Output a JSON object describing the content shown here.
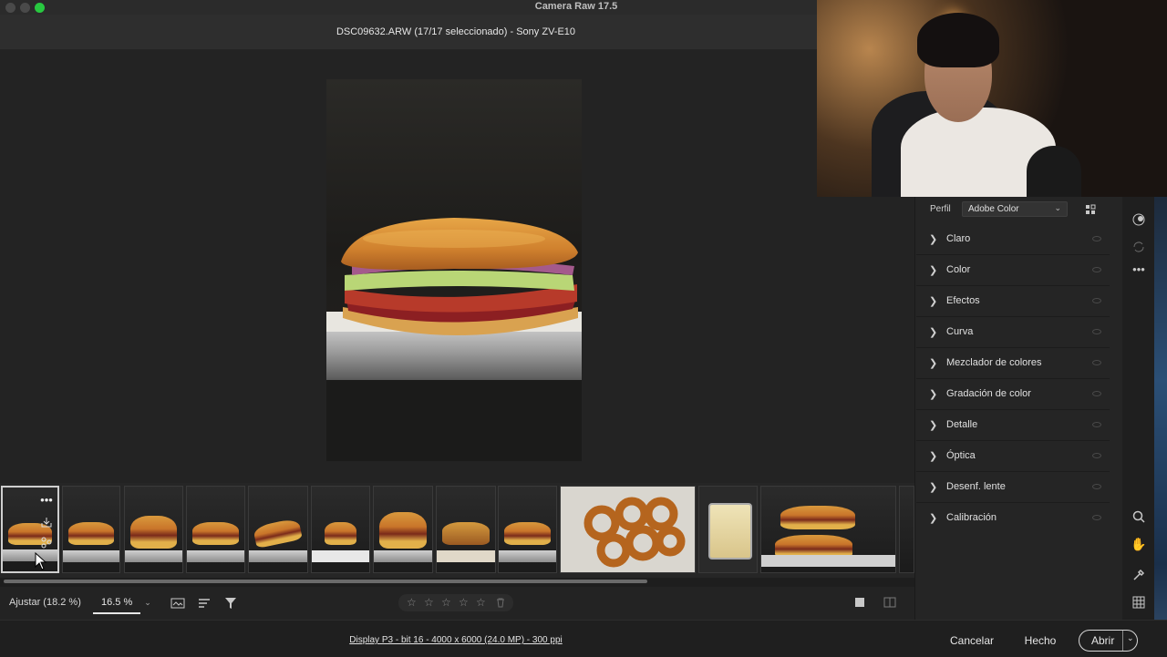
{
  "window": {
    "app_title": "Camera Raw 17.5",
    "traffic_colors": [
      "#4a4a4a",
      "#4a4a4a",
      "#28c840"
    ]
  },
  "file_header": {
    "text": "DSC09632.ARW (17/17 seleccionado) -  Sony ZV-E10"
  },
  "filmstrip": {
    "selected_index": 0,
    "thumbnail_overlay_icons": [
      "more-icon",
      "export-icon",
      "presets-icon"
    ],
    "thumbnail_count": 15
  },
  "bottom_toolbar": {
    "fit_label": "Ajustar (18.2 %)",
    "zoom_value": "16.5 %",
    "rating_stars": 5
  },
  "status": {
    "info_link": "Display P3 - bit 16 - 4000 x 6000 (24.0 MP) - 300 ppi"
  },
  "actions": {
    "cancel": "Cancelar",
    "done": "Hecho",
    "open": "Abrir"
  },
  "panel": {
    "profile_label": "Perfil",
    "profile_value": "Adobe Color",
    "sections": [
      {
        "label": "Claro"
      },
      {
        "label": "Color"
      },
      {
        "label": "Efectos"
      },
      {
        "label": "Curva"
      },
      {
        "label": "Mezclador de colores"
      },
      {
        "label": "Gradación de color"
      },
      {
        "label": "Detalle"
      },
      {
        "label": "Óptica"
      },
      {
        "label": "Desenf. lente"
      },
      {
        "label": "Calibración"
      }
    ]
  },
  "colors": {
    "accent_selected_border": "#cfcfcf",
    "panel_bg": "#252525",
    "canvas_bg": "#232323"
  }
}
